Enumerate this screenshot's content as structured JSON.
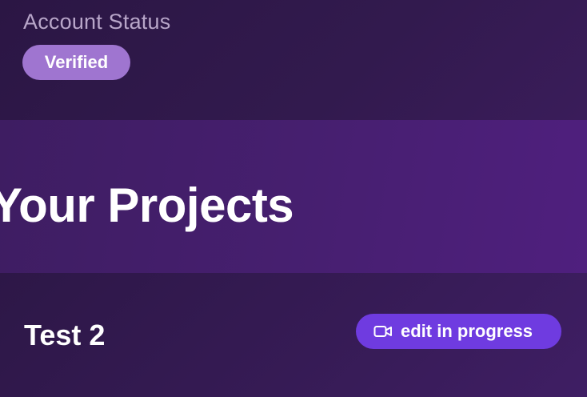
{
  "account": {
    "label": "Account Status",
    "status_badge": "Verified"
  },
  "projects": {
    "title": "Your Projects",
    "items": [
      {
        "name": "Test 2",
        "status": "edit in progress",
        "status_icon": "video-camera-icon"
      }
    ]
  },
  "colors": {
    "verified_badge": "#9f75d0",
    "status_pill": "#6f3be0",
    "band": "#461f6f"
  }
}
